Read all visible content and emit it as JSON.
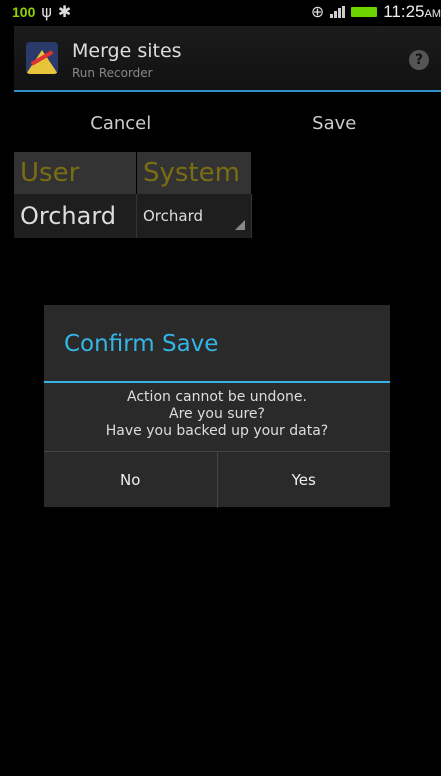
{
  "status_bar": {
    "battery_level": "100",
    "time": "11:25",
    "ampm": "AM",
    "battery_color": "#6ed400"
  },
  "action_bar": {
    "title": "Merge sites",
    "subtitle": "Run Recorder",
    "help_glyph": "?"
  },
  "buttons": {
    "cancel": "Cancel",
    "save": "Save"
  },
  "table": {
    "headers": [
      "User",
      "System"
    ],
    "rows": [
      {
        "user": "Orchard",
        "system": "Orchard"
      }
    ]
  },
  "dialog": {
    "title": "Confirm Save",
    "message_lines": [
      "Action cannot be undone.",
      "Are you sure?",
      "Have you backed up your data?"
    ],
    "no": "No",
    "yes": "Yes",
    "accent": "#35b5e5"
  }
}
